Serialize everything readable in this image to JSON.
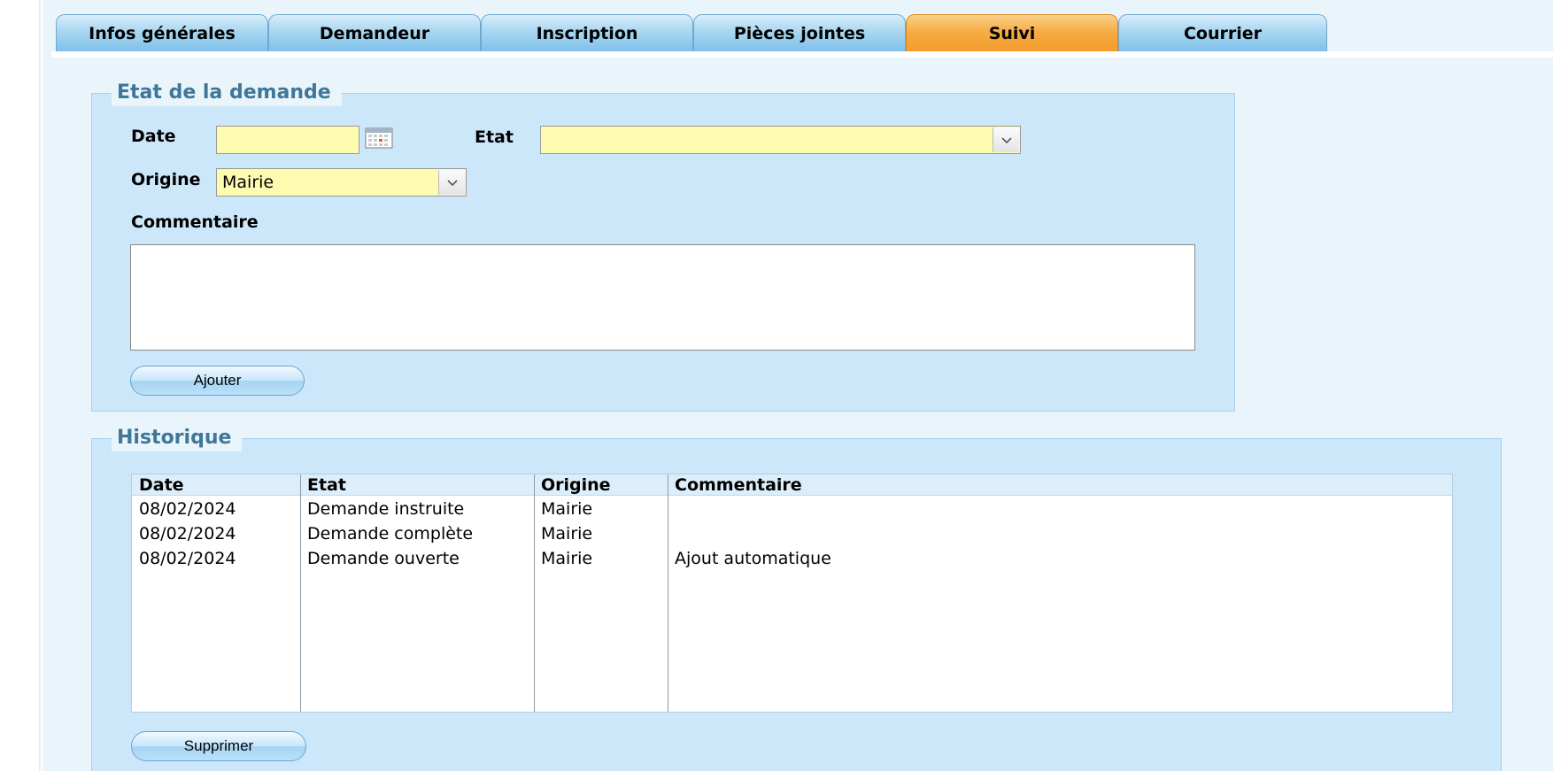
{
  "tabs": [
    {
      "label": "Infos générales",
      "active": false
    },
    {
      "label": "Demandeur",
      "active": false
    },
    {
      "label": "Inscription",
      "active": false
    },
    {
      "label": "Pièces jointes",
      "active": false
    },
    {
      "label": "Suivi",
      "active": true
    },
    {
      "label": "Courrier",
      "active": false
    }
  ],
  "etat_section": {
    "legend": "Etat de la demande",
    "date_label": "Date",
    "date_value": "",
    "etat_label": "Etat",
    "etat_value": "",
    "origine_label": "Origine",
    "origine_value": "Mairie",
    "commentaire_label": "Commentaire",
    "commentaire_value": "",
    "add_button": "Ajouter"
  },
  "historique": {
    "legend": "Historique",
    "columns": [
      "Date",
      "Etat",
      "Origine",
      "Commentaire"
    ],
    "rows": [
      [
        "08/02/2024",
        "Demande instruite",
        "Mairie",
        ""
      ],
      [
        "08/02/2024",
        "Demande complète",
        "Mairie",
        ""
      ],
      [
        "08/02/2024",
        "Demande ouverte",
        "Mairie",
        "Ajout automatique"
      ]
    ],
    "delete_button": "Supprimer"
  },
  "colors": {
    "active_tab": "#f6ac45",
    "tab": "#a9d7f1",
    "panel": "#cce7fa",
    "legend_text": "#3e7799",
    "input_bg": "#fdfbb0"
  }
}
